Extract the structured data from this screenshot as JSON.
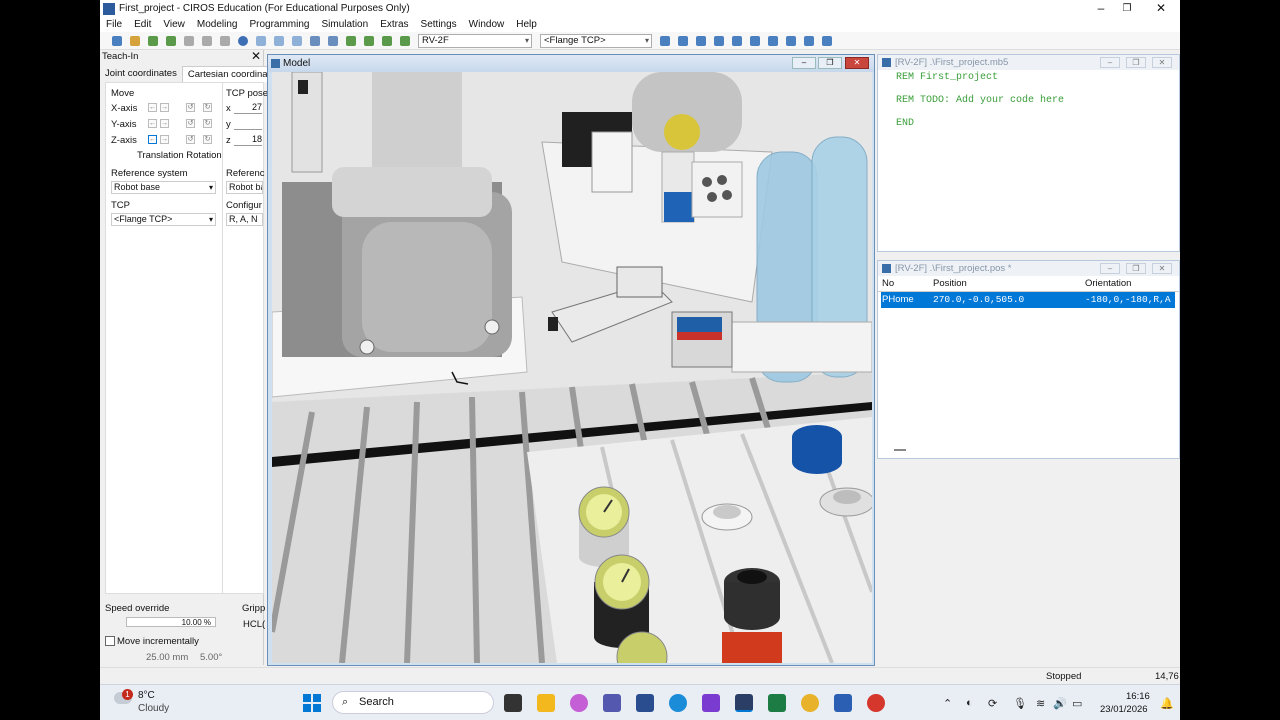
{
  "window": {
    "title": "First_project - CIROS Education (For Educational Purposes Only)",
    "minimize": "–",
    "maximize": "❐",
    "close": "✕"
  },
  "menu": [
    "File",
    "Edit",
    "View",
    "Modeling",
    "Programming",
    "Simulation",
    "Extras",
    "Settings",
    "Window",
    "Help"
  ],
  "toolbar": {
    "robot": "RV-2F",
    "tcp": "<Flange TCP>"
  },
  "teach_in": {
    "title": "Teach-In",
    "close": "✕",
    "tabs": [
      "Joint coordinates",
      "Cartesian coordinat"
    ],
    "move_label": "Move",
    "tcp_pose_label": "TCP pose",
    "axes": [
      "X-axis",
      "Y-axis",
      "Z-axis"
    ],
    "pose_labels": [
      "x",
      "y",
      "z"
    ],
    "pose_values": [
      "27",
      "",
      "18"
    ],
    "translation_rotation": "Translation Rotation",
    "reference_system_label": "Reference system",
    "reference_system_value": "Robot base",
    "reference_label2": "Referenc",
    "reference_value2": "Robot ba",
    "tcp_label": "TCP",
    "tcp_value": "<Flange TCP>",
    "config_label": "Configur",
    "config_value": "R, A, N",
    "speed_override_label": "Speed override",
    "speed_override_value": "10.00 %",
    "gripper_label": "Gripp",
    "gripper_value": "HCL(",
    "move_incrementally": "Move incrementally",
    "increment_mm": "25.00 mm",
    "increment_deg": "5.00°"
  },
  "model_window": {
    "title": "Model"
  },
  "program_window": {
    "title": "[RV-2F] .\\First_project.mb5",
    "lines": [
      "REM First_project",
      "",
      "REM TODO: Add your code here",
      "",
      "END"
    ]
  },
  "positions_window": {
    "title": "[RV-2F] .\\First_project.pos *",
    "columns": [
      "No",
      "Position",
      "Orientation"
    ],
    "rows": [
      {
        "no": "PHome",
        "position": "270.0,-0.0,505.0",
        "orientation": "-180,0,-180,R,A"
      }
    ]
  },
  "status": {
    "state": "Stopped",
    "value": "14,76"
  },
  "taskbar": {
    "weather_temp": "8°C",
    "weather_desc": "Cloudy",
    "weather_badge": "1",
    "search": "Search",
    "time": "16:16",
    "date": "23/01/2026"
  },
  "colors": {
    "accent": "#0078d7",
    "code_green": "#3a9e3a",
    "close_red": "#c9463d"
  }
}
